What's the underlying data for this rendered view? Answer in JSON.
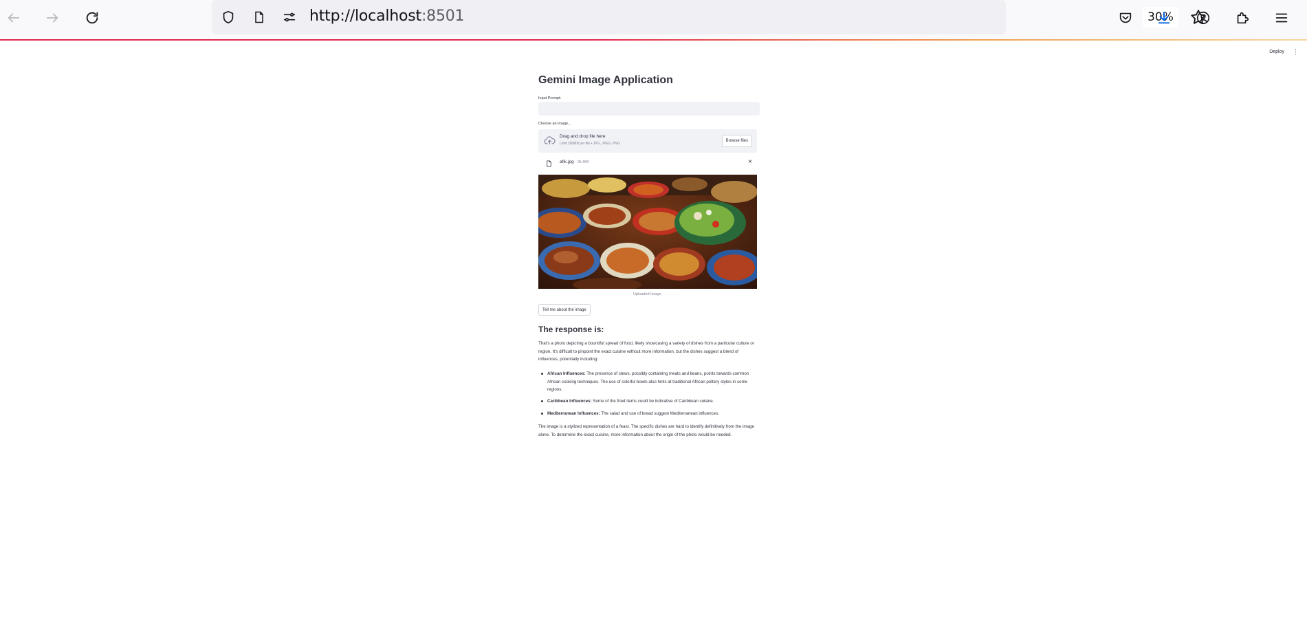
{
  "browser": {
    "url_host": "http://localhost",
    "url_port": ":8501",
    "zoom": "30%",
    "accent_progress": "#e22850"
  },
  "header": {
    "deploy_label": "Deploy",
    "menu_label": "⋮"
  },
  "app": {
    "title": "Gemini Image Application",
    "input_label": "Input Prompt:",
    "input_value": "",
    "uploader_label": "Choose an image...",
    "dropzone_title": "Drag and drop file here",
    "dropzone_sub": "Limit 200MB per file • JPG, JPEG, PNG",
    "browse_label": "Browse files",
    "file_name": "afik.jpg",
    "file_size": "35.4KB",
    "remove_label": "×",
    "image_caption": "Uploaded Image.",
    "submit_label": "Tell me about the image",
    "response_heading": "The response is:",
    "intro": "That's a photo depicting a bountiful spread of food, likely showcasing a variety of dishes from a particular culture or region. It's difficult to pinpoint the exact cuisine without more information, but the dishes suggest a blend of influences, potentially including:",
    "bullets": [
      {
        "bold": "African Influences:",
        "text": " The presence of stews, possibly containing meats and beans, points towards common African cooking techniques. The use of colorful bowls also hints at traditional African pottery styles in some regions."
      },
      {
        "bold": "Caribbean Influences:",
        "text": " Some of the fried items could be indicative of Caribbean cuisine."
      },
      {
        "bold": "Mediterranean Influences:",
        "text": " The salad and use of bread suggest Mediterranean influences."
      }
    ],
    "outro": "The image is a stylized representation of a feast. The specific dishes are hard to identify definitively from the image alone. To determine the exact cuisine, more information about the origin of the photo would be needed."
  }
}
